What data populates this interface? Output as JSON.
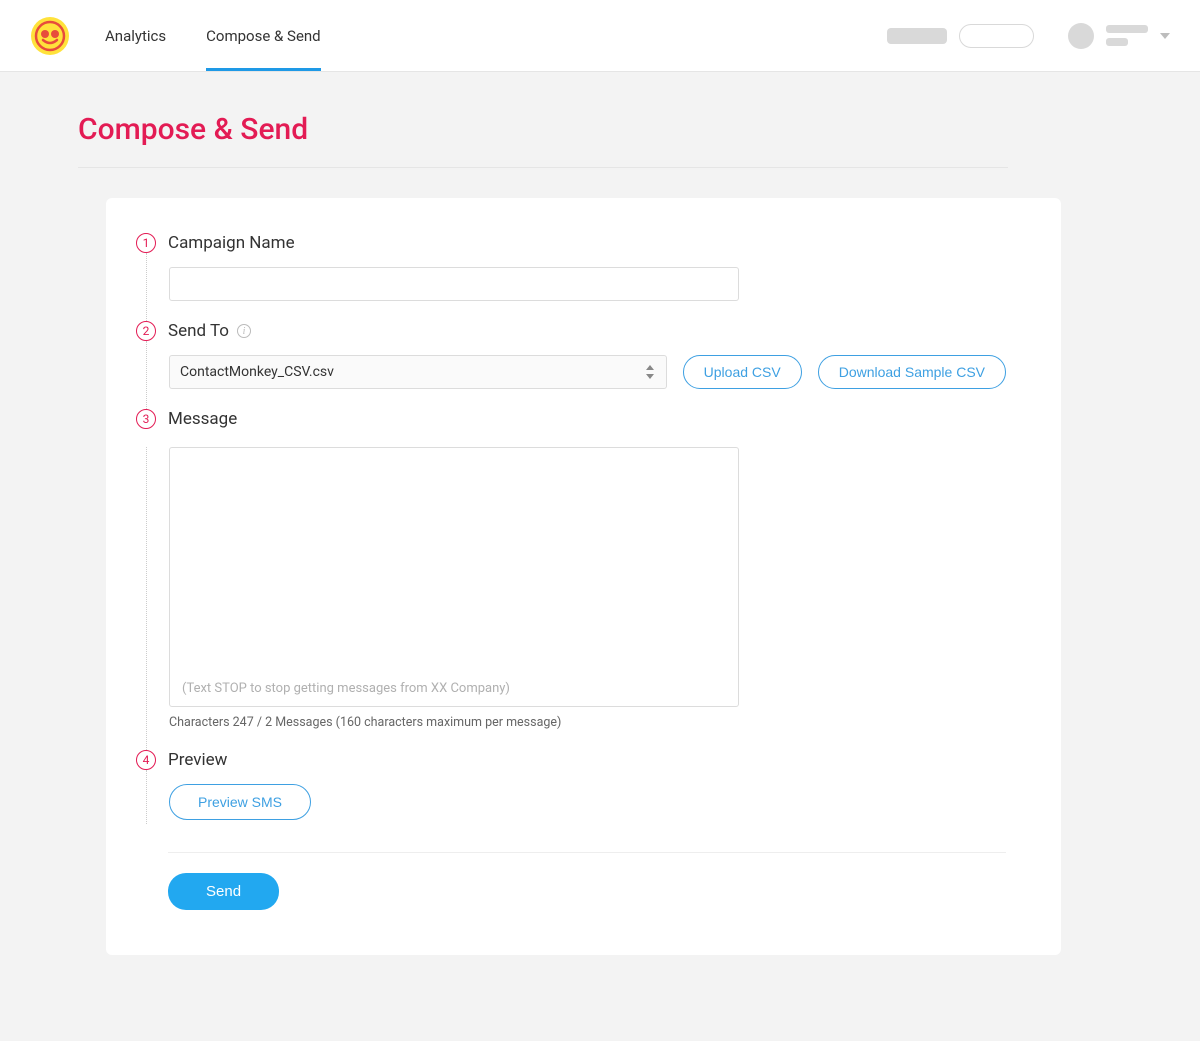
{
  "nav": {
    "analytics": "Analytics",
    "compose": "Compose & Send"
  },
  "page_title": "Compose & Send",
  "steps": {
    "num1": "1",
    "num2": "2",
    "num3": "3",
    "num4": "4",
    "campaign_name": "Campaign Name",
    "send_to": "Send To",
    "message": "Message",
    "preview": "Preview"
  },
  "campaign": {
    "value": ""
  },
  "send_to": {
    "selected": "ContactMonkey_CSV.csv",
    "upload_btn": "Upload CSV",
    "download_btn": "Download Sample CSV"
  },
  "message": {
    "value": "",
    "stop_hint": "(Text STOP to stop getting messages from XX Company)",
    "counter": "Characters 247 / 2 Messages  (160 characters maximum per message)"
  },
  "preview_btn": "Preview SMS",
  "send_btn": "Send"
}
